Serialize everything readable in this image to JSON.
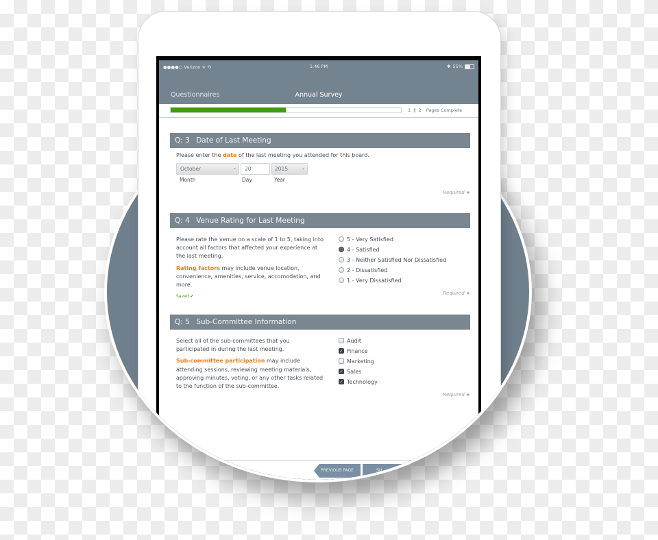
{
  "status_bar": {
    "carrier": "●●●●○ Verizon ᯤ ⟲",
    "time": "1:46 PM",
    "bluetooth": "✱",
    "battery_percent": "55%",
    "battery_level": 0.55
  },
  "nav": {
    "back_label": "Questionnaires",
    "title": "Annual Survey"
  },
  "progress": {
    "fraction": 0.5,
    "current": "1",
    "separator": "‖",
    "total": "2",
    "label": "Pages Complete"
  },
  "questions": [
    {
      "prefix": "Q:",
      "number": "3",
      "title": "Date of Last Meeting",
      "prompt_before": "Please enter the ",
      "prompt_highlight": "date",
      "prompt_after": " of the last meeting you attended for this board.",
      "month": {
        "value": "October",
        "label": "Month"
      },
      "day": {
        "value": "20",
        "label": "Day"
      },
      "year": {
        "value": "2015",
        "label": "Year"
      },
      "required_label": "Required"
    },
    {
      "prefix": "Q:",
      "number": "4",
      "title": "Venue Rating for Last Meeting",
      "description": "Please rate the venue on a scale of 1 to 5, taking into account all factors that affected your experience at the last meeting.",
      "note_highlight": "Rating factors",
      "note_rest": " may include venue location, convenience, amenities, service, accomodation, and more.",
      "saved_label": "Saved",
      "options": [
        {
          "label": "5 - Very Satisfied",
          "selected": false
        },
        {
          "label": "4 - Satisfied",
          "selected": true
        },
        {
          "label": "3 - Neither Satisfied Nor Dissatisfied",
          "selected": false
        },
        {
          "label": "2 - Dissatisfied",
          "selected": false
        },
        {
          "label": "1 - Very Dissatisfied",
          "selected": false
        }
      ],
      "required_label": "Required"
    },
    {
      "prefix": "Q:",
      "number": "5",
      "title": "Sub-Committee Information",
      "description": "Select all of the sub-committees that you participated in during the last meeting.",
      "note_highlight": "Sub-committee participation",
      "note_rest": " may include attending sessions, reviewing meeting materials, approving minutes, voting, or any other tasks related to the function of the sub-committee.",
      "options": [
        {
          "label": "Audit",
          "checked": false
        },
        {
          "label": "Finance",
          "checked": true
        },
        {
          "label": "Marketing",
          "checked": false
        },
        {
          "label": "Sales",
          "checked": true
        },
        {
          "label": "Technology",
          "checked": true
        }
      ],
      "required_label": "Required"
    }
  ],
  "footer": {
    "previous_label": "PREVIOUS PAGE",
    "next_label": "SU..."
  },
  "icons": {
    "caret": "▾",
    "check": "✔",
    "checkbox_check": "✓",
    "star": "★"
  },
  "colors": {
    "nav": "#748390",
    "progress": "#3f9e0a",
    "highlight": "#f07d18",
    "circle": "#6f7f8c"
  }
}
